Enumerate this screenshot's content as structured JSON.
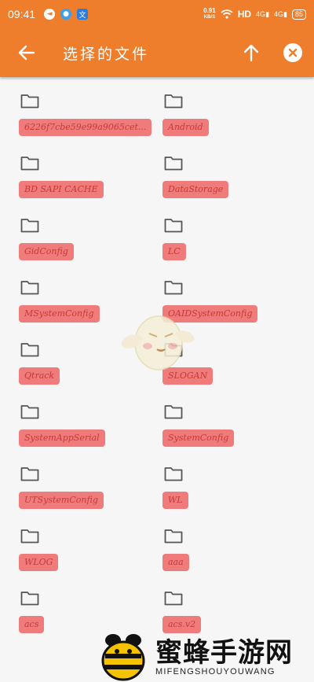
{
  "status_bar": {
    "time": "09:41",
    "speed_value": "0.91",
    "speed_unit": "KB/S",
    "hd_label": "HD",
    "signal_1": "4G",
    "signal_2": "4G",
    "battery": "85"
  },
  "app_bar": {
    "title": "选择的文件",
    "back_icon": "arrow-left-icon",
    "up_icon": "arrow-up-icon",
    "close_icon": "close-circle-icon"
  },
  "files": [
    {
      "name": "6226f7cbe59e99a9065cet..."
    },
    {
      "name": "Android"
    },
    {
      "name": "BD SAPI CACHE"
    },
    {
      "name": "DataStorage"
    },
    {
      "name": "GidConfig"
    },
    {
      "name": "LC"
    },
    {
      "name": "MSystemConfig"
    },
    {
      "name": "OAIDSystemConfig"
    },
    {
      "name": "Qtrack"
    },
    {
      "name": "SLOGAN"
    },
    {
      "name": "SystemAppSerial"
    },
    {
      "name": "SystemConfig"
    },
    {
      "name": "UTSystemConfig"
    },
    {
      "name": "WL"
    },
    {
      "name": "WLOG"
    },
    {
      "name": "aaa"
    },
    {
      "name": "acs"
    },
    {
      "name": "acs.v2"
    }
  ],
  "watermark": {
    "name": "蜜蜂手游网",
    "subtitle": "MIFENGSHOUYOUWANG"
  },
  "colors": {
    "accent": "#ee7e2c",
    "chip_bg": "#f07b7b",
    "chip_text": "#c43a3a",
    "folder_stroke": "#555555"
  }
}
